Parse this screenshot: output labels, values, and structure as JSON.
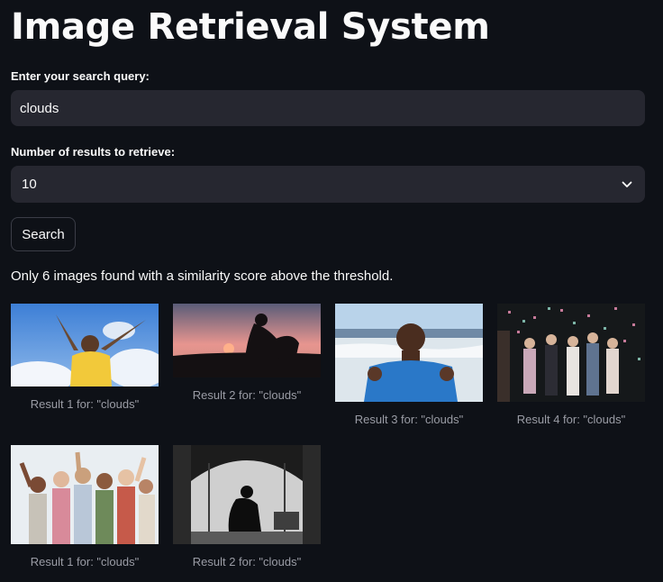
{
  "page": {
    "title": "Image Retrieval System"
  },
  "query": {
    "label": "Enter your search query:",
    "value": "clouds"
  },
  "num_results": {
    "label": "Number of results to retrieve:",
    "value": "10"
  },
  "search_button": {
    "label": "Search"
  },
  "notice": "Only 6 images found with a similarity score above the threshold.",
  "results": [
    {
      "caption": "Result 1 for: \"clouds\"",
      "image": "woman-in-yellow-shirt-arms-raised-against-blue-sky-with-clouds"
    },
    {
      "caption": "Result 2 for: \"clouds\"",
      "image": "silhouette-of-person-sitting-at-sunset"
    },
    {
      "caption": "Result 3 for: \"clouds\"",
      "image": "man-in-blue-shirt-thumbs-up-at-beach"
    },
    {
      "caption": "Result 4 for: \"clouds\"",
      "image": "group-of-friends-partying-with-confetti"
    },
    {
      "caption": "Result 1 for: \"clouds\"",
      "image": "large-group-of-happy-people-waving"
    },
    {
      "caption": "Result 2 for: \"clouds\"",
      "image": "black-and-white-person-sitting-alone-in-doorway"
    }
  ],
  "colors": {
    "background": "#0e1117",
    "input_background": "#262730",
    "text": "#fafafa",
    "caption": "#9a9ca5"
  }
}
